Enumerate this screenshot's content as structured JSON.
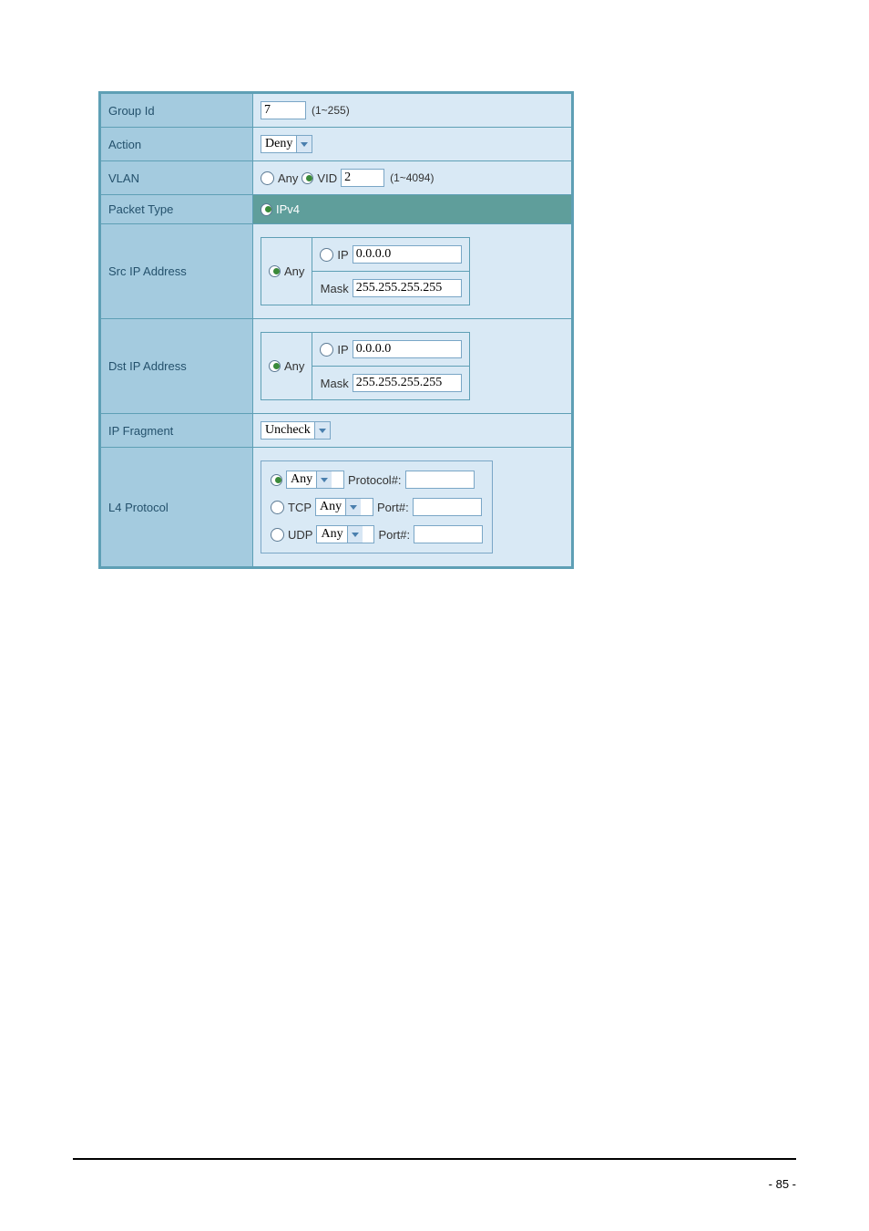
{
  "rows": {
    "groupId": {
      "label": "Group Id",
      "value": "7",
      "hint": "(1~255)"
    },
    "action": {
      "label": "Action",
      "value": "Deny"
    },
    "vlan": {
      "label": "VLAN",
      "anyLabel": "Any",
      "anySelected": false,
      "vidLabel": "VID",
      "vidSelected": true,
      "vidValue": "2",
      "hint": "(1~4094)"
    },
    "packetType": {
      "label": "Packet Type",
      "option": "IPv4",
      "selected": true
    },
    "srcIp": {
      "label": "Src IP Address",
      "anyLabel": "Any",
      "anySelected": true,
      "ipLabel": "IP",
      "ipSelected": false,
      "ipValue": "0.0.0.0",
      "maskLabel": "Mask",
      "maskValue": "255.255.255.255"
    },
    "dstIp": {
      "label": "Dst IP Address",
      "anyLabel": "Any",
      "anySelected": true,
      "ipLabel": "IP",
      "ipSelected": false,
      "ipValue": "0.0.0.0",
      "maskLabel": "Mask",
      "maskValue": "255.255.255.255"
    },
    "ipFragment": {
      "label": "IP Fragment",
      "value": "Uncheck"
    },
    "l4": {
      "label": "L4 Protocol",
      "protoSel": "Any",
      "protoSelected": true,
      "protoFieldLabel": "Protocol#:",
      "protoFieldValue": "",
      "tcpLabel": "TCP",
      "tcpSelected": false,
      "tcpSel": "Any",
      "tcpPortLabel": "Port#:",
      "tcpPortValue": "",
      "udpLabel": "UDP",
      "udpSelected": false,
      "udpSel": "Any",
      "udpPortLabel": "Port#:",
      "udpPortValue": ""
    }
  },
  "pageNumber": "- 85 -"
}
